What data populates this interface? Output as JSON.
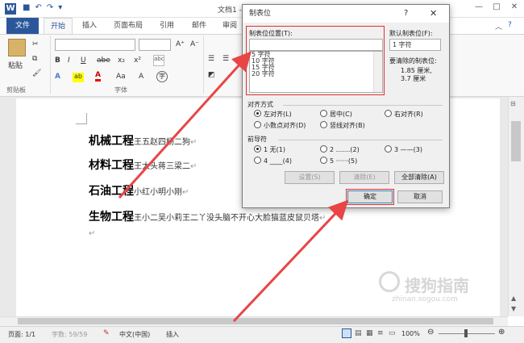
{
  "window": {
    "title": "文档1 - Microsoft Word",
    "logo": "W"
  },
  "qat_icons": [
    "save-icon",
    "undo-icon",
    "redo-icon",
    "customize-icon"
  ],
  "tabs": [
    "文件",
    "开始",
    "插入",
    "页面布局",
    "引用",
    "邮件",
    "审阅"
  ],
  "ribbon": {
    "paste": "粘贴",
    "clipboard": "剪贴板",
    "font": "字体",
    "font_btns": [
      "B",
      "I",
      "U",
      "abe",
      "x₂",
      "x²"
    ],
    "font_size_btns": [
      "A",
      "Aa",
      "A",
      "A"
    ],
    "font_grow": "A⁺",
    "font_shrink": "A⁻"
  },
  "document": {
    "lines": [
      {
        "heading": "机械工程",
        "text": "王五赵四杨二狗"
      },
      {
        "heading": "材料工程",
        "text": "王大头蒋三梁二"
      },
      {
        "heading": "石油工程",
        "text": "小红小明小刚"
      },
      {
        "heading": "生物工程",
        "text": "王小二吴小莉王二丫没头脑不开心大脸猫蓝皮鼠贝塔"
      }
    ],
    "pilcrow": "↵"
  },
  "status": {
    "page": "页面: 1/1",
    "words": "字数: 59/59",
    "lang": "中文(中国)",
    "mode": "插入",
    "zoom": "100%"
  },
  "watermark": {
    "text": "搜狗指南",
    "url": "zhinan.sogou.com"
  },
  "dialog": {
    "title": "制表位",
    "help": "?",
    "close": "✕",
    "pos_label": "制表位位置(T):",
    "pos_value": "",
    "list": [
      "5 字符",
      "10 字符",
      "15 字符",
      "20 字符"
    ],
    "default_label": "默认制表位(F):",
    "default_value": "1 字符",
    "clear_label": "要清除的制表位:",
    "clear_values": [
      "1.85 厘米,",
      "3.7 厘米"
    ],
    "align_label": "对齐方式",
    "align_opts": [
      "左对齐(L)",
      "居中(C)",
      "右对齐(R)",
      "小数点对齐(D)",
      "竖线对齐(B)"
    ],
    "leader_label": "前导符",
    "leader_opts": [
      "1 无(1)",
      "2 .......(2)",
      "3 ——(3)",
      "4 ____(4)",
      "5 ······(5)"
    ],
    "btn_set": "设置(S)",
    "btn_clear": "清除(E)",
    "btn_clear_all": "全部清除(A)",
    "btn_ok": "确定",
    "btn_cancel": "取消"
  }
}
